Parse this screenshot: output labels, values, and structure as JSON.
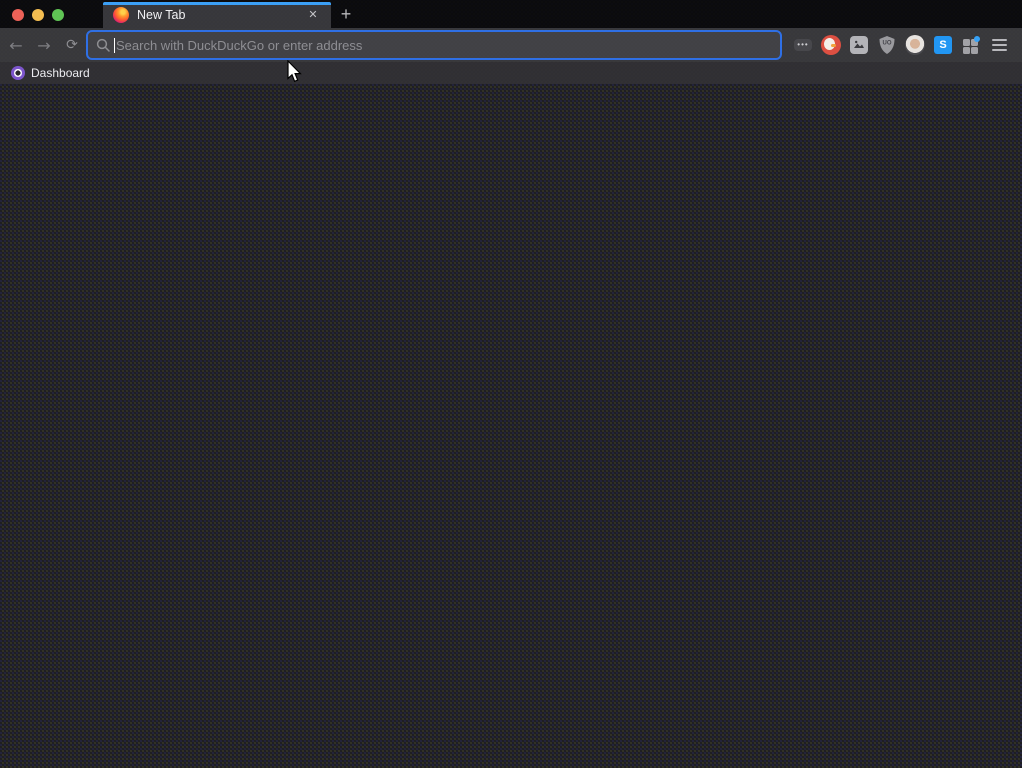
{
  "tab_bar": {
    "active_tab": {
      "label": "New Tab",
      "favicon": "firefox-icon"
    },
    "glyphs": {
      "close": "✕",
      "new_tab": "+"
    }
  },
  "navigation": {
    "glyphs": {
      "back": "←",
      "forward": "→",
      "reload": "⟳"
    }
  },
  "url_bar": {
    "value": "",
    "placeholder": "Search with DuckDuckGo or enter address",
    "icon": "magnifier-icon",
    "focused": true
  },
  "extensions": {
    "overflow_glyph": "•••",
    "ublock_label": "UO",
    "s_label": "S",
    "items": [
      "unified-extensions-overflow",
      "duckduckgo",
      "image-tool",
      "ublock-origin",
      "profile-avatar",
      "s-app",
      "apps-grid-with-notification",
      "app-menu"
    ]
  },
  "bookmarks_bar": {
    "items": [
      {
        "label": "Dashboard",
        "favicon": "purple-donut-icon"
      }
    ]
  },
  "window_controls": [
    "close",
    "minimize",
    "zoom"
  ],
  "colors": {
    "tab_accent_blue": "#3ba0f6",
    "urlbar_focus_blue": "#2e6fe5",
    "traffic_red": "#ec6157",
    "traffic_yellow": "#f4bd50",
    "traffic_green": "#5fc454",
    "ddg_red": "#dd4f41",
    "s_app_blue": "#2196f3",
    "extension_dot_blue": "#35a2f8",
    "toolbar_bg": "#38383b",
    "tabbar_bg": "#0b0b0d",
    "bookmarks_bg": "#302f33",
    "content_bg": "#1e1e21"
  }
}
